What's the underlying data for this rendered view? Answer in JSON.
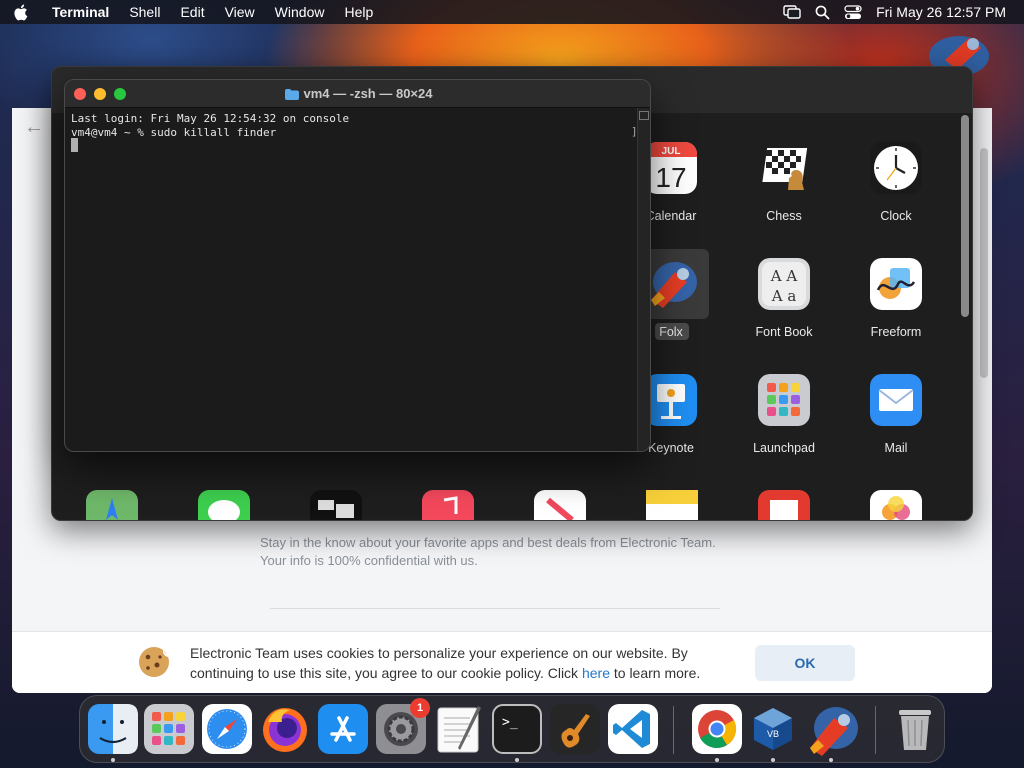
{
  "menubar": {
    "app_name": "Terminal",
    "items": [
      "Shell",
      "Edit",
      "View",
      "Window",
      "Help"
    ],
    "clock": "Fri May 26  12:57 PM"
  },
  "browser": {
    "newsletter_line1": "Stay in the know about your favorite apps and best deals from Electronic Team.",
    "newsletter_line2": "Your info is 100% confidential with us.",
    "cookie_text_before": "Electronic Team uses cookies to personalize your experience on our website. By continuing to use this site, you agree to our cookie policy. Click ",
    "cookie_link": "here",
    "cookie_text_after": " to learn more.",
    "ok_label": "OK"
  },
  "terminal": {
    "title": "vm4 — -zsh — 80×24",
    "line1": "Last login: Fri May 26 12:54:32 on console",
    "line2": "vm4@vm4 ~ % sudo killall finder"
  },
  "finder": {
    "calendar_month": "JUL",
    "calendar_day": "17",
    "apps": [
      {
        "label": "Calendar",
        "icon": "calendar-icon"
      },
      {
        "label": "Chess",
        "icon": "chess-icon"
      },
      {
        "label": "Clock",
        "icon": "clock-icon"
      },
      {
        "label": "Folx",
        "icon": "folx-icon"
      },
      {
        "label": "Font Book",
        "icon": "font-book-icon"
      },
      {
        "label": "Freeform",
        "icon": "freeform-icon"
      },
      {
        "label": "Keynote",
        "icon": "keynote-icon"
      },
      {
        "label": "Launchpad",
        "icon": "launchpad-icon"
      },
      {
        "label": "Mail",
        "icon": "mail-icon"
      }
    ],
    "font_book_glyphs": "AA Aa"
  },
  "dock": {
    "apps": [
      "Finder",
      "Launchpad",
      "Safari",
      "Firefox",
      "App Store",
      "System Settings",
      "TextEdit",
      "Terminal",
      "GarageBand",
      "Visual Studio Code",
      "Google Chrome",
      "VirtualBox",
      "Folx",
      "Trash"
    ],
    "settings_badge": "1",
    "terminal_prompt": ">_"
  },
  "colors": {
    "accent_blue": "#2478c7",
    "traffic_red": "#fe5f57",
    "traffic_yellow": "#febc2e",
    "traffic_green": "#28c840"
  }
}
